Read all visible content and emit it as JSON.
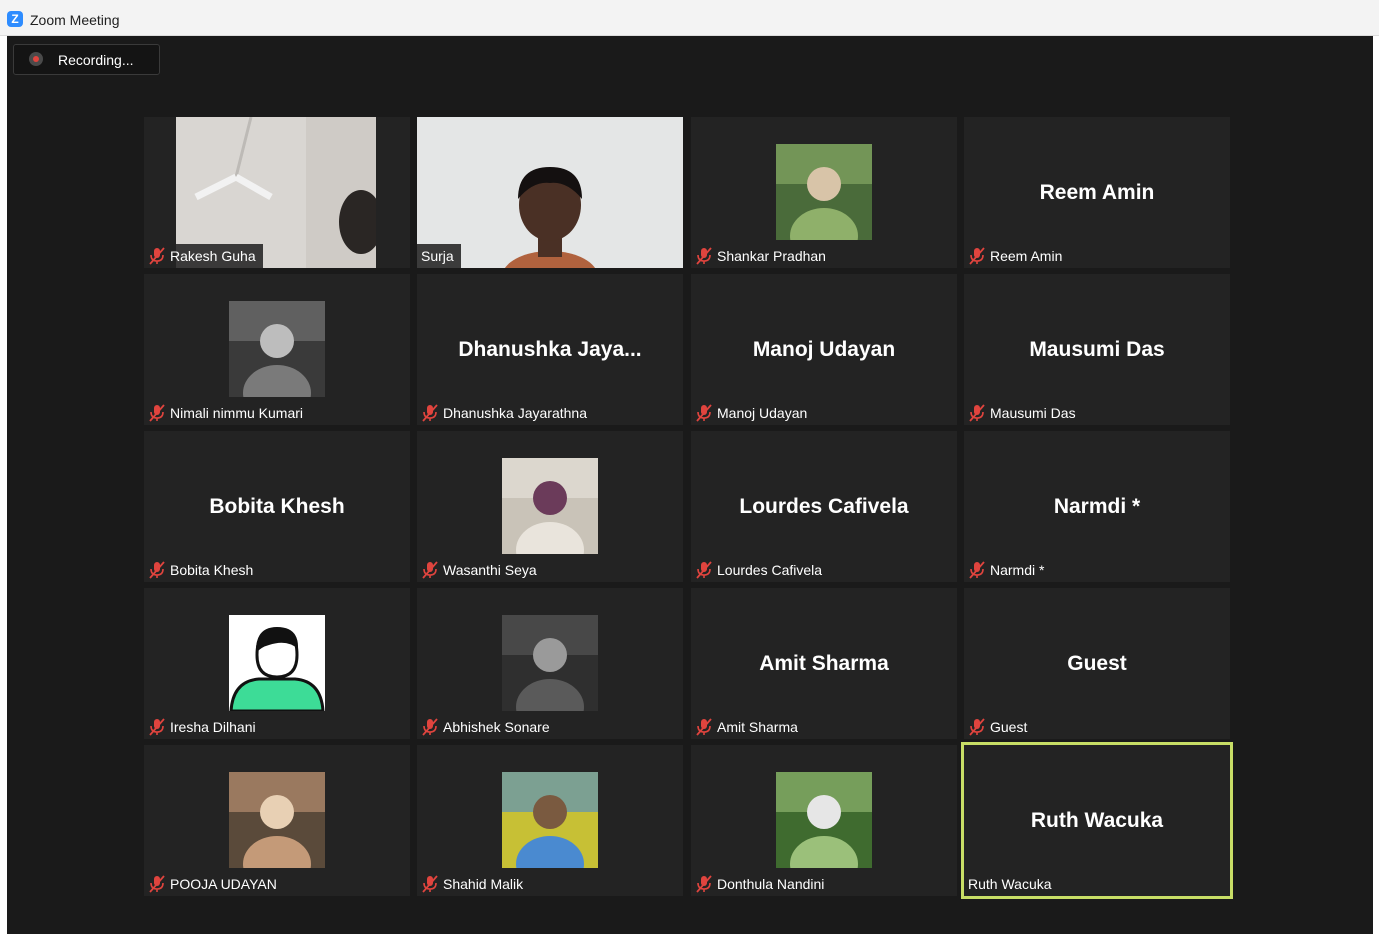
{
  "window": {
    "title": "Zoom Meeting",
    "logo_letter": "Z"
  },
  "recording": {
    "label": "Recording..."
  },
  "participants": [
    {
      "label": "Rakesh Guha",
      "muted": true,
      "media": "video-room"
    },
    {
      "label": "Surja",
      "muted": false,
      "media": "video-person"
    },
    {
      "label": "Shankar Pradhan",
      "muted": true,
      "media": "photo"
    },
    {
      "label": "Reem Amin",
      "display": "Reem Amin",
      "muted": true,
      "media": "name"
    },
    {
      "label": "Nimali nimmu Kumari",
      "muted": true,
      "media": "photo"
    },
    {
      "label": "Dhanushka Jayarathna",
      "display": "Dhanushka  Jaya...",
      "muted": true,
      "media": "name"
    },
    {
      "label": "Manoj Udayan",
      "display": "Manoj Udayan",
      "muted": true,
      "media": "name"
    },
    {
      "label": "Mausumi Das",
      "display": "Mausumi Das",
      "muted": true,
      "media": "name"
    },
    {
      "label": "Bobita Khesh",
      "display": "Bobita Khesh",
      "muted": true,
      "media": "name"
    },
    {
      "label": "Wasanthi Seya",
      "muted": true,
      "media": "photo"
    },
    {
      "label": "Lourdes Cafivela",
      "display": "Lourdes Cafivela",
      "muted": true,
      "media": "name"
    },
    {
      "label": "Narmdi *",
      "display": "Narmdi *",
      "muted": true,
      "media": "name"
    },
    {
      "label": "Iresha Dilhani",
      "muted": true,
      "media": "default-avatar"
    },
    {
      "label": "Abhishek Sonare",
      "muted": true,
      "media": "photo"
    },
    {
      "label": "Amit Sharma",
      "display": "Amit Sharma",
      "muted": true,
      "media": "name"
    },
    {
      "label": "Guest",
      "display": "Guest",
      "muted": true,
      "media": "name"
    },
    {
      "label": "POOJA UDAYAN",
      "muted": true,
      "media": "photo"
    },
    {
      "label": "Shahid Malik",
      "muted": true,
      "media": "photo"
    },
    {
      "label": "Donthula Nandini",
      "muted": true,
      "media": "photo"
    },
    {
      "label": "Ruth Wacuka",
      "display": "Ruth Wacuka",
      "muted": false,
      "media": "name",
      "active_speaker": true
    }
  ],
  "colors": {
    "stage": "#1a1a1a",
    "tile": "#232323",
    "muted_icon": "#e0443e",
    "active_speaker_border": "#c8de66"
  }
}
